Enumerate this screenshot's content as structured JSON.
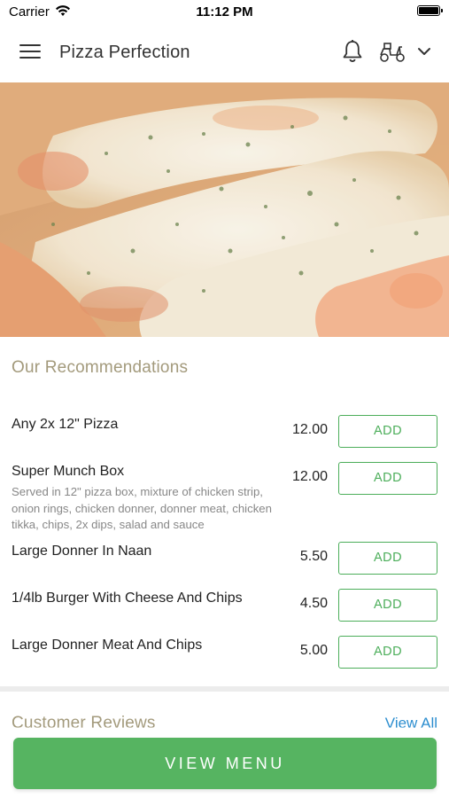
{
  "status_bar": {
    "carrier": "Carrier",
    "time": "11:12 PM",
    "icons": [
      "wifi-icon",
      "battery-icon"
    ]
  },
  "header": {
    "title": "Pizza Perfection",
    "icons": [
      "menu-icon",
      "bell-icon",
      "delivery-scooter-icon",
      "chevron-down-icon"
    ]
  },
  "hero": {
    "image": "pizza-closeup"
  },
  "recommendations": {
    "title": "Our Recommendations",
    "add_label": "ADD",
    "items": [
      {
        "name": "Any 2x 12\" Pizza",
        "description": "",
        "price": "12.00"
      },
      {
        "name": "Super Munch Box",
        "description": "Served in 12\" pizza box, mixture of chicken strip, onion rings, chicken donner, donner meat, chicken tikka, chips, 2x dips, salad and sauce",
        "price": "12.00"
      },
      {
        "name": "Large Donner In Naan",
        "description": "",
        "price": "5.50"
      },
      {
        "name": "1/4lb Burger With Cheese And Chips",
        "description": "",
        "price": "4.50"
      },
      {
        "name": "Large Donner Meat And Chips",
        "description": "",
        "price": "5.00"
      }
    ]
  },
  "reviews": {
    "title": "Customer Reviews",
    "view_all": "View All"
  },
  "view_menu_button": "VIEW MENU",
  "colors": {
    "accent_green": "#56b461",
    "section_title": "#a39a7c",
    "link_blue": "#2d8ecf"
  }
}
